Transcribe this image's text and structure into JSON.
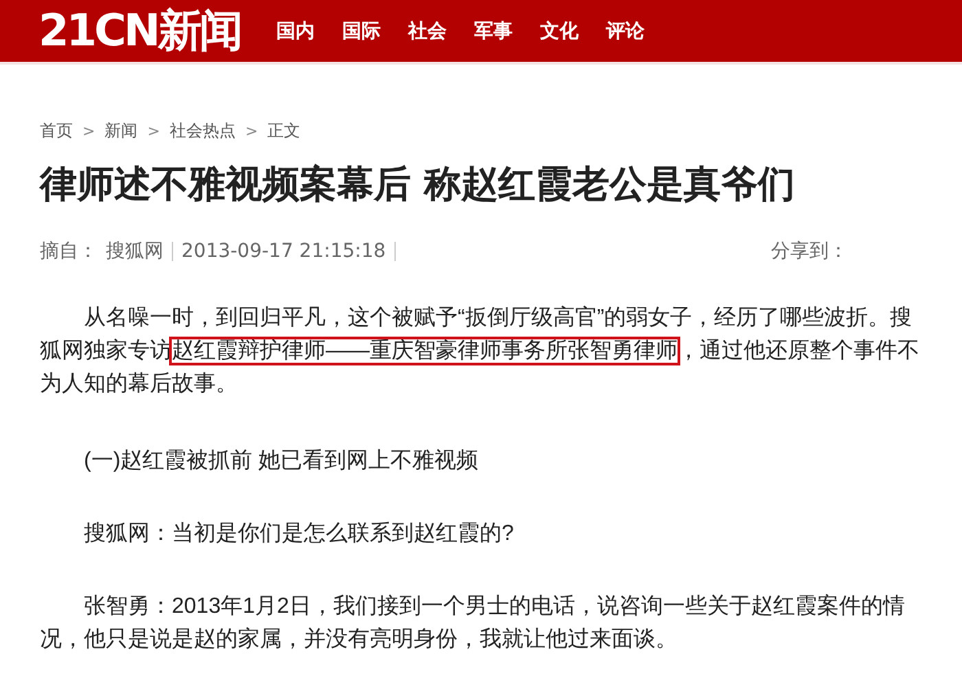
{
  "header": {
    "logo": "21CN新闻",
    "nav": [
      {
        "label": "国内"
      },
      {
        "label": "国际"
      },
      {
        "label": "社会"
      },
      {
        "label": "军事"
      },
      {
        "label": "文化"
      },
      {
        "label": "评论"
      }
    ]
  },
  "breadcrumb": [
    "首页",
    "新闻",
    "社会热点",
    "正文"
  ],
  "breadcrumb_separator": ">",
  "title": "律师述不雅视频案幕后 称赵红霞老公是真爷们",
  "meta": {
    "source_label": "摘自：",
    "source": "搜狐网",
    "date": "2013-09-17 21:15:18",
    "share": "分享到："
  },
  "paragraphs": [
    {
      "segments": [
        {
          "text": "从名噪一时，到回归平凡，这个被赋予“扳倒厅级高官”的弱女子，经历了哪些波折。搜狐网独家专访",
          "highlighted": false
        },
        {
          "text": "赵红霞辩护律师——重庆智豪律师事务所张智勇律师",
          "highlighted": true
        },
        {
          "text": "，通过他还原整个事件不为人知的幕后故事。",
          "highlighted": false
        }
      ]
    },
    {
      "segments": [
        {
          "text": "(一)赵红霞被抓前 她已看到网上不雅视频",
          "highlighted": false
        }
      ]
    },
    {
      "segments": [
        {
          "text": "搜狐网：当初是你们是怎么联系到赵红霞的?",
          "highlighted": false
        }
      ]
    },
    {
      "segments": [
        {
          "text": "张智勇：2013年1月2日，我们接到一个男士的电话，说咨询一些关于赵红霞案件的情况，他只是说是赵的家属，并没有亮明身份，我就让他过来面谈。",
          "highlighted": false
        }
      ]
    }
  ]
}
